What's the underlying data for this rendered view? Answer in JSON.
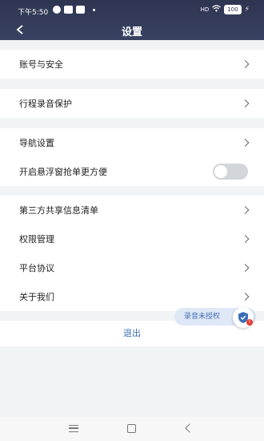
{
  "status_bar": {
    "time": "下午5:50",
    "signal": "HD",
    "battery": "100"
  },
  "header": {
    "title": "设置"
  },
  "groups": [
    {
      "items": [
        {
          "label": "账号与安全"
        }
      ]
    },
    {
      "items": [
        {
          "label": "行程录音保护"
        }
      ]
    },
    {
      "items": [
        {
          "label": "导航设置"
        },
        {
          "label": "开启悬浮窗抢单更方便",
          "toggle_on": false
        }
      ]
    },
    {
      "items": [
        {
          "label": "第三方共享信息清单"
        },
        {
          "label": "权限管理"
        },
        {
          "label": "平台协议"
        },
        {
          "label": "关于我们"
        }
      ]
    }
  ],
  "logout_label": "退出",
  "recording": {
    "label": "录音未授权",
    "badge": "!"
  },
  "colors": {
    "header_bg": "#2e3551",
    "page_bg": "#f2f3f5",
    "logout_text": "#3b6fb6",
    "pill_bg": "#dfe8f7"
  }
}
